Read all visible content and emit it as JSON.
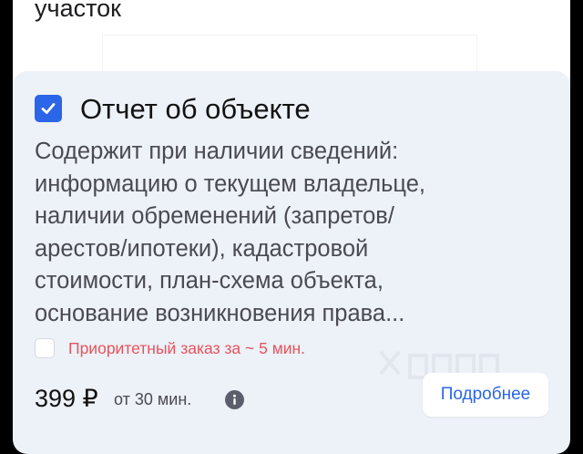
{
  "previous_card": {
    "text": "участок"
  },
  "report_card": {
    "checked": true,
    "title": "Отчет об объекте",
    "description_lines": [
      "Содержит при наличии сведений:",
      "информацию о текущем владельце,",
      "наличии обременений (запретов/",
      "арестов/ипотеки), кадастровой",
      "стоимости, план-схема объекта,",
      "основание возникновения права..."
    ],
    "priority": {
      "checked": false,
      "label": "Приоритетный заказ за ~ 5 мин."
    },
    "price": "399 ₽",
    "duration": "от 30 мин.",
    "more_button": "Подробнее"
  },
  "colors": {
    "accent": "#2b66e8",
    "priority_text": "#e6545c",
    "card_background": "#edf1f8"
  },
  "icons": {
    "checkbox": "check-icon",
    "info": "info-icon"
  }
}
